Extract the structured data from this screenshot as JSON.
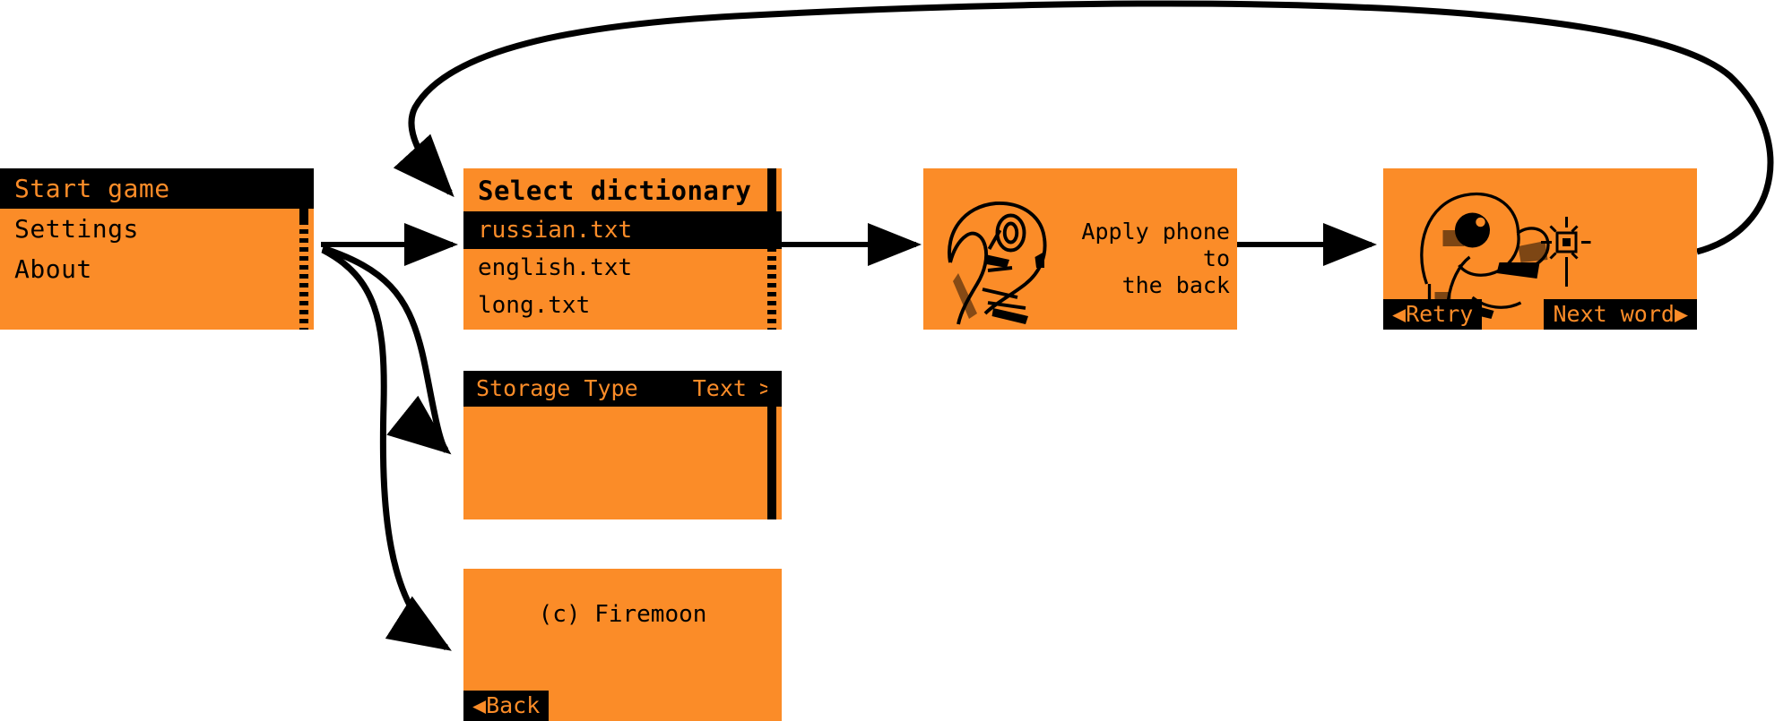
{
  "meta": {
    "kind": "mobile-app-flow-diagram",
    "background_color": "#FFFFFF",
    "screen_color": "#FB8C28",
    "ink_color": "#000000"
  },
  "screens": [
    {
      "id": "main-menu",
      "name": "main-menu-screen",
      "items": [
        {
          "label": "Start game",
          "selected": true
        },
        {
          "label": "Settings",
          "selected": false
        },
        {
          "label": "About",
          "selected": false
        }
      ],
      "scrollbar": {
        "present": true
      }
    },
    {
      "id": "select-dictionary",
      "name": "select-dictionary-screen",
      "title": "Select dictionary",
      "items": [
        {
          "label": "russian.txt",
          "selected": true
        },
        {
          "label": "english.txt",
          "selected": false
        },
        {
          "label": "long.txt",
          "selected": false
        }
      ],
      "scrollbar": {
        "present": true
      }
    },
    {
      "id": "settings",
      "name": "settings-screen",
      "rows": [
        {
          "key": "Storage Type",
          "value": "Text",
          "chevron": ">"
        }
      ],
      "scrollbar": {
        "present": true
      }
    },
    {
      "id": "about",
      "name": "about-screen",
      "text": "(c) Firemoon",
      "softkey_left": "Back",
      "softkey_left_arrow": "◀"
    },
    {
      "id": "apply-phone",
      "name": "apply-phone-screen",
      "caption": "Apply phone to\nthe back",
      "art": "head-profile-pixel-art"
    },
    {
      "id": "result",
      "name": "result-screen",
      "softkey_left": "Retry",
      "softkey_left_arrow": "◀",
      "softkey_right": "Next word",
      "softkey_right_arrow": "▶",
      "art": "head-fist-flash-pixel-art"
    }
  ],
  "flow": {
    "arrows": [
      {
        "from": "main-menu",
        "to": "select-dictionary",
        "style": "straight"
      },
      {
        "from": "main-menu",
        "to": "settings",
        "style": "curved"
      },
      {
        "from": "main-menu",
        "to": "about",
        "style": "curved"
      },
      {
        "from": "select-dictionary",
        "to": "apply-phone",
        "style": "straight"
      },
      {
        "from": "apply-phone",
        "to": "result",
        "style": "straight"
      },
      {
        "from": "result",
        "to": "select-dictionary",
        "style": "loop-arc"
      }
    ]
  }
}
